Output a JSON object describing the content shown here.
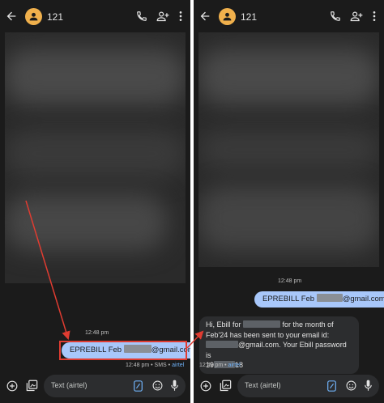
{
  "screens": [
    {
      "id": "left",
      "contact_name": "121",
      "timestamp": "12:48 pm",
      "sent_message": {
        "prefix": "EPREBILL Feb",
        "suffix": "@gmail.com"
      },
      "delivery": {
        "time": "12:48 pm",
        "sep1": "•",
        "type": "SMS",
        "sep2": "•",
        "sim": "airtel"
      },
      "compose_placeholder": "Text (airtel)"
    },
    {
      "id": "right",
      "contact_name": "121",
      "timestamp": "12:48 pm",
      "sent_message": {
        "prefix": "EPREBILL Feb",
        "suffix": "@gmail.com"
      },
      "received_message": {
        "line1_a": "Hi, Ebill for",
        "line1_b": "for the month of",
        "line2": "Feb'24 has been sent to your email id:",
        "line3_b": "@gmail.com. Your Ebill password is",
        "line4_a": "19",
        "line4_b": "18"
      },
      "delivery": {
        "time": "12:48 pm",
        "sep": "•",
        "sim": "airtel"
      },
      "compose_placeholder": "Text (airtel)"
    }
  ],
  "icons": [
    "back-arrow-icon",
    "contact-avatar-icon",
    "phone-icon",
    "add-person-icon",
    "more-vert-icon",
    "add-icon",
    "gallery-icon",
    "magic-compose-icon",
    "emoji-icon",
    "mic-icon"
  ],
  "colors": {
    "background": "#1b1b1b",
    "avatar": "#f0b04c",
    "outgoing_bubble": "#a8c7fa",
    "incoming_bubble": "#2c2d2f",
    "annotation": "#e03c31",
    "sim_label": "#6fb0f5"
  }
}
